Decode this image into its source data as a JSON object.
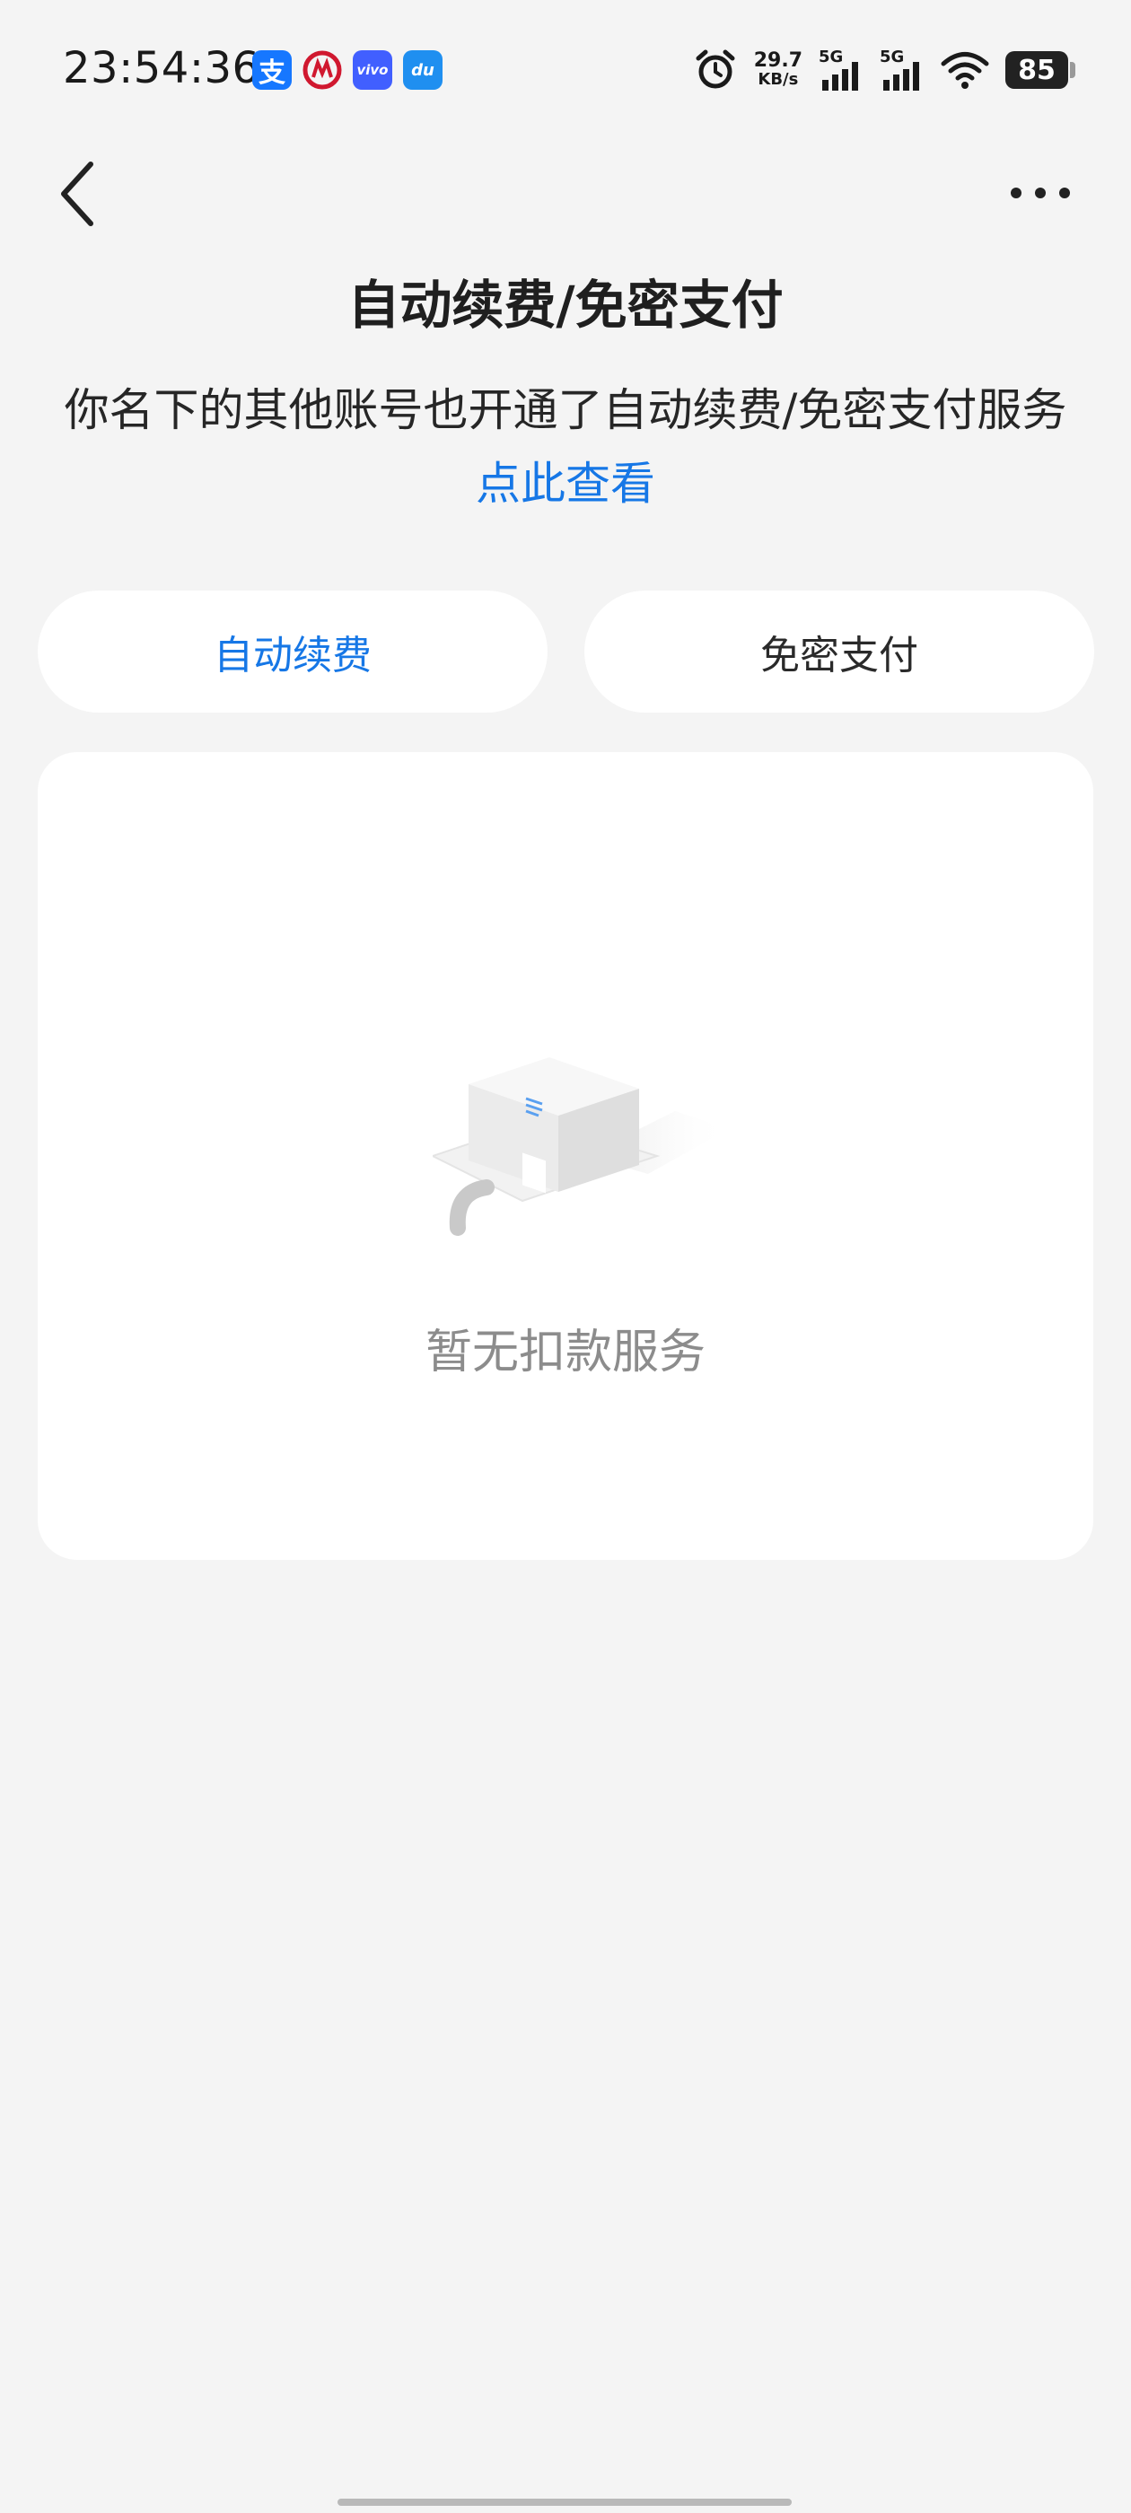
{
  "status_bar": {
    "time": "23:54:36",
    "net_speed_value": "29.7",
    "net_speed_unit": "KB/s",
    "signal_1": "5G",
    "signal_2": "5G",
    "battery": "85",
    "notification_icons": [
      "alipay-icon",
      "cmb-bank-icon",
      "vivo-icon",
      "du-icon"
    ]
  },
  "header": {
    "title": "自动续费/免密支付"
  },
  "notice": {
    "text": "你名下的其他账号也开通了自动续费/免密支付服务",
    "link": "点此查看"
  },
  "tabs": [
    {
      "label": "自动续费",
      "active": true
    },
    {
      "label": "免密支付",
      "active": false
    }
  ],
  "empty_state": {
    "message": "暂无扣款服务"
  },
  "colors": {
    "accent": "#1677e6",
    "background": "#f4f4f4",
    "card": "#ffffff",
    "muted_text": "#8c8c8c"
  }
}
